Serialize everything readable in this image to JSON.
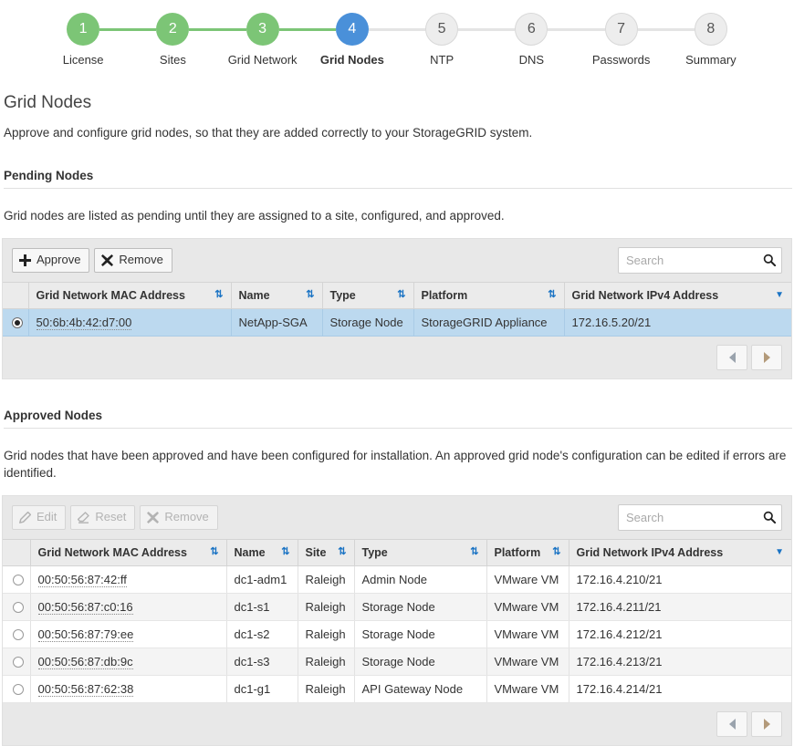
{
  "wizard": {
    "steps": [
      {
        "number": "1",
        "label": "License",
        "state": "done"
      },
      {
        "number": "2",
        "label": "Sites",
        "state": "done"
      },
      {
        "number": "3",
        "label": "Grid Network",
        "state": "done"
      },
      {
        "number": "4",
        "label": "Grid Nodes",
        "state": "current"
      },
      {
        "number": "5",
        "label": "NTP",
        "state": "todo"
      },
      {
        "number": "6",
        "label": "DNS",
        "state": "todo"
      },
      {
        "number": "7",
        "label": "Passwords",
        "state": "todo"
      },
      {
        "number": "8",
        "label": "Summary",
        "state": "todo"
      }
    ],
    "colors": {
      "done": "#7cc576",
      "current": "#4a90d9",
      "todo": "#ededed",
      "line_done": "#7cc576",
      "line_todo": "#e4e4e4"
    }
  },
  "page": {
    "title": "Grid Nodes",
    "description": "Approve and configure grid nodes, so that they are added correctly to your StorageGRID system."
  },
  "pending": {
    "heading": "Pending Nodes",
    "description": "Grid nodes are listed as pending until they are assigned to a site, configured, and approved.",
    "toolbar": {
      "approve_label": "Approve",
      "approve_icon": "plus-icon",
      "remove_label": "Remove",
      "remove_icon": "cross-icon"
    },
    "search": {
      "placeholder": "Search",
      "value": "",
      "icon": "search-icon"
    },
    "columns": [
      {
        "label": "Grid Network MAC Address",
        "icon": "sort-icon"
      },
      {
        "label": "Name",
        "icon": "sort-icon"
      },
      {
        "label": "Type",
        "icon": "sort-icon"
      },
      {
        "label": "Platform",
        "icon": "sort-icon"
      },
      {
        "label": "Grid Network IPv4 Address",
        "icon": "chevron-down-icon"
      }
    ],
    "rows": [
      {
        "selected": true,
        "mac": "50:6b:4b:42:d7:00",
        "name": "NetApp-SGA",
        "type": "Storage Node",
        "platform": "StorageGRID Appliance",
        "ipv4": "172.16.5.20/21"
      }
    ],
    "pager": {
      "prev_icon": "triangle-left-icon",
      "next_icon": "triangle-right-icon"
    }
  },
  "approved": {
    "heading": "Approved Nodes",
    "description": "Grid nodes that have been approved and have been configured for installation. An approved grid node's configuration can be edited if errors are identified.",
    "toolbar": {
      "edit_label": "Edit",
      "edit_icon": "pencil-icon",
      "edit_disabled": true,
      "reset_label": "Reset",
      "reset_icon": "eraser-icon",
      "reset_disabled": true,
      "remove_label": "Remove",
      "remove_icon": "cross-icon",
      "remove_disabled": true
    },
    "search": {
      "placeholder": "Search",
      "value": "",
      "icon": "search-icon"
    },
    "columns": [
      {
        "label": "Grid Network MAC Address",
        "icon": "sort-icon"
      },
      {
        "label": "Name",
        "icon": "sort-icon"
      },
      {
        "label": "Site",
        "icon": "sort-icon"
      },
      {
        "label": "Type",
        "icon": "sort-icon"
      },
      {
        "label": "Platform",
        "icon": "sort-icon"
      },
      {
        "label": "Grid Network IPv4 Address",
        "icon": "chevron-down-icon"
      }
    ],
    "rows": [
      {
        "selected": false,
        "mac": "00:50:56:87:42:ff",
        "name": "dc1-adm1",
        "site": "Raleigh",
        "type": "Admin Node",
        "platform": "VMware VM",
        "ipv4": "172.16.4.210/21"
      },
      {
        "selected": false,
        "mac": "00:50:56:87:c0:16",
        "name": "dc1-s1",
        "site": "Raleigh",
        "type": "Storage Node",
        "platform": "VMware VM",
        "ipv4": "172.16.4.211/21"
      },
      {
        "selected": false,
        "mac": "00:50:56:87:79:ee",
        "name": "dc1-s2",
        "site": "Raleigh",
        "type": "Storage Node",
        "platform": "VMware VM",
        "ipv4": "172.16.4.212/21"
      },
      {
        "selected": false,
        "mac": "00:50:56:87:db:9c",
        "name": "dc1-s3",
        "site": "Raleigh",
        "type": "Storage Node",
        "platform": "VMware VM",
        "ipv4": "172.16.4.213/21"
      },
      {
        "selected": false,
        "mac": "00:50:56:87:62:38",
        "name": "dc1-g1",
        "site": "Raleigh",
        "type": "API Gateway Node",
        "platform": "VMware VM",
        "ipv4": "172.16.4.214/21"
      }
    ],
    "pager": {
      "prev_icon": "triangle-left-icon",
      "next_icon": "triangle-right-icon"
    }
  }
}
